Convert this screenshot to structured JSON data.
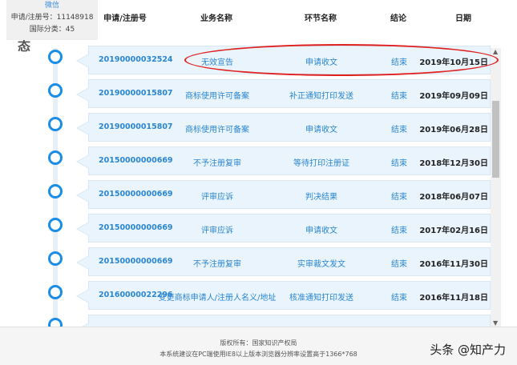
{
  "header": {
    "col_app_no": "申请/注册号",
    "col_business": "业务名称",
    "col_step": "环节名称",
    "col_result": "结论",
    "col_date": "日期"
  },
  "info": {
    "wechat": "微信",
    "app_no": "申请/注册号：11148918",
    "intl_class": "国际分类：45"
  },
  "side_char": "态",
  "rows": [
    {
      "app_no": "20190000032524",
      "business": "无效宣告",
      "step": "申请收文",
      "result": "结束",
      "date": "2019年10月15日"
    },
    {
      "app_no": "20190000015807",
      "business": "商标使用许可备案",
      "step": "补正通知打印发送",
      "result": "结束",
      "date": "2019年09月09日"
    },
    {
      "app_no": "20190000015807",
      "business": "商标使用许可备案",
      "step": "申请收文",
      "result": "结束",
      "date": "2019年06月28日"
    },
    {
      "app_no": "20150000000669",
      "business": "不予注册复审",
      "step": "等待打印注册证",
      "result": "结束",
      "date": "2018年12月30日"
    },
    {
      "app_no": "20150000000669",
      "business": "评审应诉",
      "step": "判决结果",
      "result": "结束",
      "date": "2018年06月07日"
    },
    {
      "app_no": "20150000000669",
      "business": "评审应诉",
      "step": "申请收文",
      "result": "结束",
      "date": "2017年02月16日"
    },
    {
      "app_no": "20150000000669",
      "business": "不予注册复审",
      "step": "实审裁文发文",
      "result": "结束",
      "date": "2016年11月30日"
    },
    {
      "app_no": "20160000022296",
      "business": "变更商标申请人/注册人名义/地址",
      "step": "核准通知打印发送",
      "result": "结束",
      "date": "2016年11月18日"
    }
  ],
  "footer": {
    "copyright": "版权所有：国家知识产权局",
    "notice": "本系统建议在PC端使用IE8以上版本浏览器分辨率设置高于1366*768"
  },
  "watermark": "头条 @知产力",
  "colors": {
    "accent_blue": "#1a8ee6",
    "row_bg": "#eaf4fc",
    "annotation_red": "#e02020"
  }
}
